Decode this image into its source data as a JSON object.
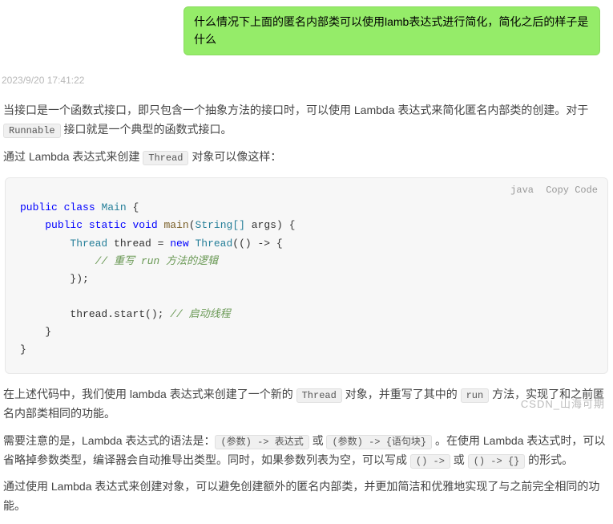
{
  "user_message": "什么情况下上面的匿名内部类可以使用lamb表达式进行简化，简化之后的样子是什么",
  "timestamp": "2023/9/20 17:41:22",
  "reply": {
    "p1_pre": "当接口是一个函数式接口，即只包含一个抽象方法的接口时，可以使用 Lambda 表达式来简化匿名内部类的创建。对于 ",
    "p1_code": "Runnable",
    "p1_post": " 接口就是一个典型的函数式接口。",
    "p2_pre": "通过 Lambda 表达式来创建 ",
    "p2_code": "Thread",
    "p2_post": " 对象可以像这样：",
    "code_lang": "java",
    "code_copy": "Copy Code",
    "code_lines": {
      "l1_kw1": "public",
      "l1_kw2": "class",
      "l1_name": "Main",
      "l1_tail": " {",
      "l2_indent": "    ",
      "l2_kw1": "public",
      "l2_kw2": "static",
      "l2_kw3": "void",
      "l2_fn": "main",
      "l2_paren_open": "(",
      "l2_type": "String[]",
      "l2_arg": " args",
      "l2_tail": ") {",
      "l3_indent": "        ",
      "l3_type1": "Thread",
      "l3_var": " thread = ",
      "l3_kw": "new",
      "l3_sp": " ",
      "l3_type2": "Thread",
      "l3_tail": "(() -> {",
      "l4_indent": "            ",
      "l4_comment": "// 重写 run 方法的逻辑",
      "l5_indent": "        ",
      "l5_text": "});",
      "l6_blank": "",
      "l7_indent": "        ",
      "l7_text": "thread.start(); ",
      "l7_comment": "// 启动线程",
      "l8_indent": "    ",
      "l8_text": "}",
      "l9_text": "}"
    },
    "p3_pre": "在上述代码中，我们使用 lambda 表达式来创建了一个新的 ",
    "p3_code1": "Thread",
    "p3_mid": " 对象，并重写了其中的 ",
    "p3_code2": "run",
    "p3_post": " 方法，实现了和之前匿名内部类相同的功能。",
    "p4_pre": "需要注意的是，Lambda 表达式的语法是：",
    "p4_code1": "(参数) -> 表达式",
    "p4_or1": " 或 ",
    "p4_code2": "(参数) -> {语句块}",
    "p4_mid": " 。在使用 Lambda 表达式时，可以省略掉参数类型，编译器会自动推导出类型。同时，如果参数列表为空，可以写成 ",
    "p4_code3": "() ->",
    "p4_or2": " 或 ",
    "p4_code4": "() -> {}",
    "p4_post": " 的形式。",
    "p5": "通过使用 Lambda 表达式来创建对象，可以避免创建额外的匿名内部类，并更加简洁和优雅地实现了与之前完全相同的功能。"
  },
  "watermark": "CSDN_山海可期"
}
